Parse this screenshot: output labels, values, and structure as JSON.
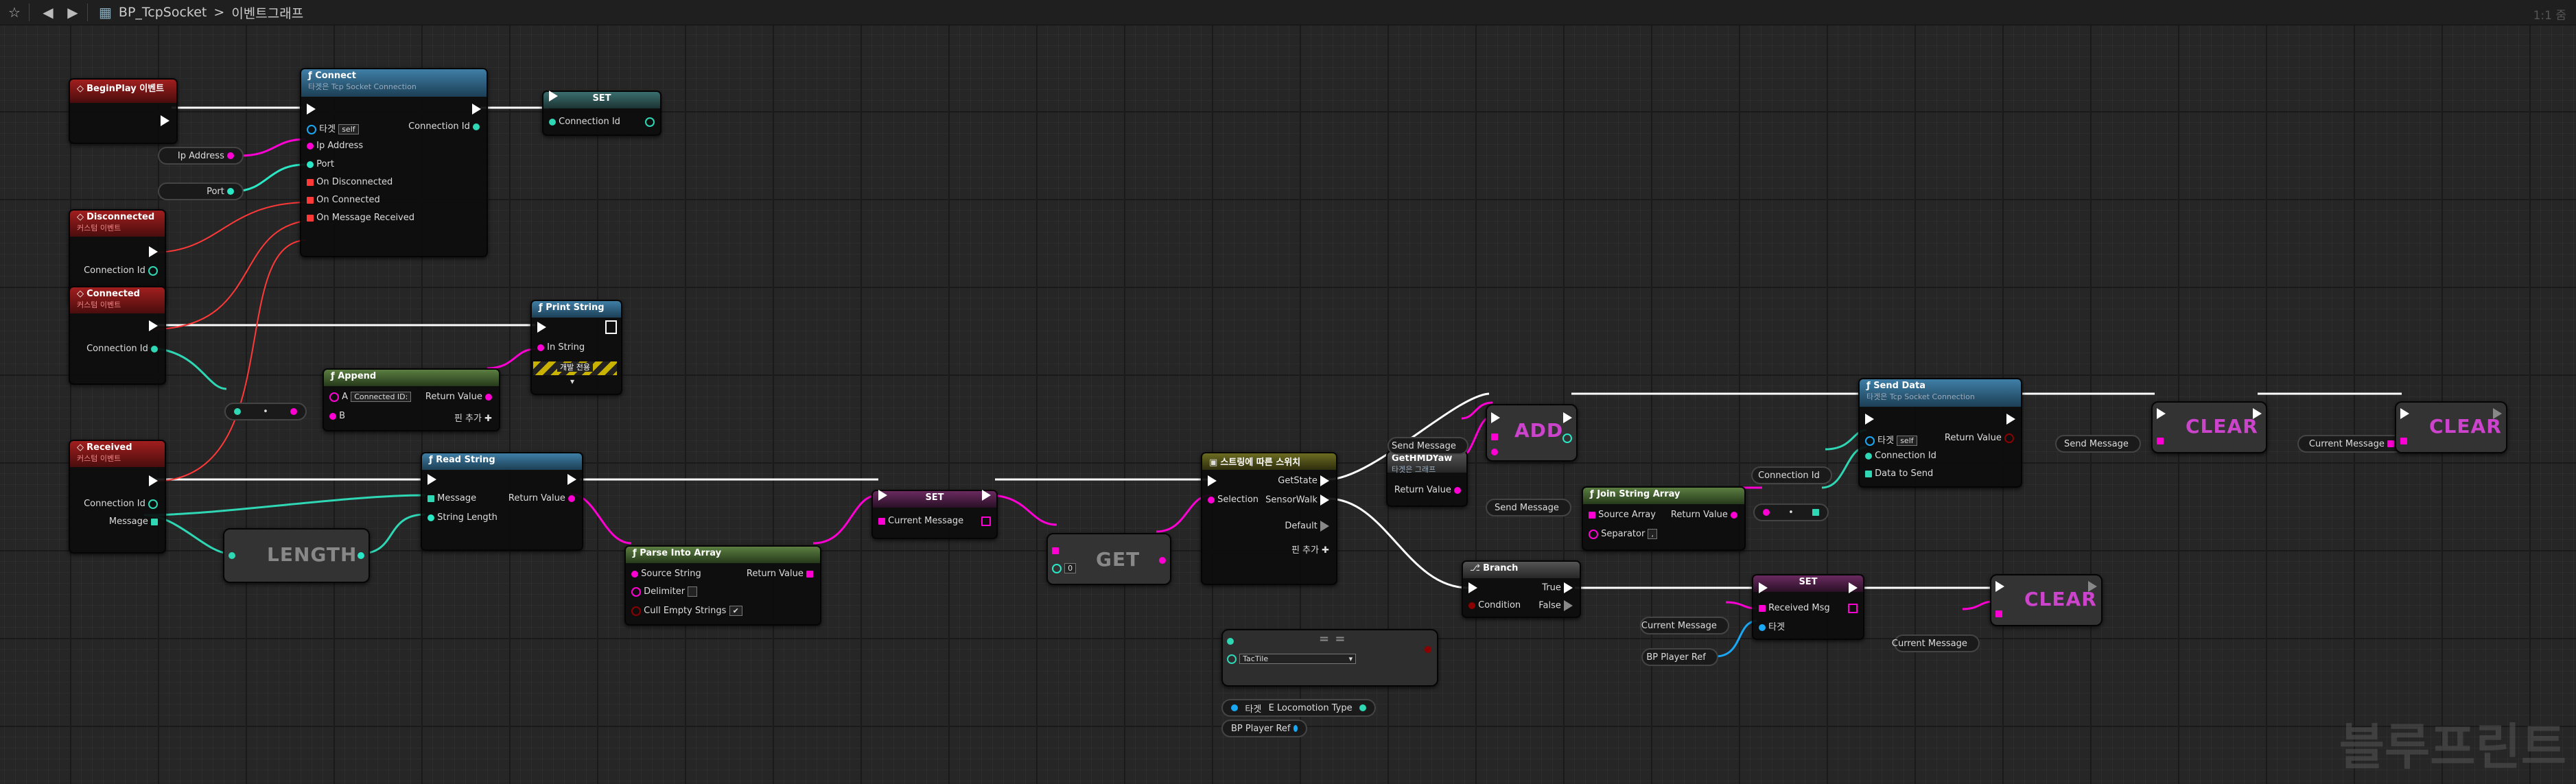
{
  "toolbar": {
    "title": "BP_TcpSocket",
    "sep": ">",
    "graph": "이벤트그래프",
    "zoom": "1:1 줌"
  },
  "watermark": "블루프린트",
  "nodes": {
    "begin_play": {
      "title": "BeginPlay 이벤트"
    },
    "connect": {
      "title": "Connect",
      "subtitle": "타겟은 Tcp Socket Connection",
      "target_label": "타겟",
      "target_value": "self",
      "pins": [
        "Ip Address",
        "Port",
        "On Disconnected",
        "On Connected",
        "On Message Received"
      ],
      "return": "Connection Id"
    },
    "set_top": {
      "title": "SET",
      "pin": "Connection Id"
    },
    "ip_var": "Ip Address",
    "port_var": "Port",
    "disconnected": {
      "title": "Disconnected",
      "subtitle": "커스텀 이벤트",
      "pin": "Connection Id"
    },
    "connected": {
      "title": "Connected",
      "subtitle": "커스텀 이벤트",
      "pin": "Connection Id"
    },
    "print_string": {
      "title": "Print String",
      "pin": "In String",
      "dev": "개발 전용"
    },
    "append": {
      "title": "Append",
      "a_label": "A",
      "a_value": "Connected ID:",
      "b_label": "B",
      "return": "Return Value",
      "add_pin": "핀 추가"
    },
    "conv1": "•",
    "received": {
      "title": "Received",
      "subtitle": "커스텀 이벤트",
      "pin1": "Connection Id",
      "pin2": "Message"
    },
    "read_string": {
      "title": "Read String",
      "pin1": "Message",
      "pin2": "String Length",
      "return": "Return Value"
    },
    "length": "LENGTH",
    "parse": {
      "title": "Parse Into Array",
      "pin1": "Source String",
      "pin2": "Delimiter",
      "pin3": "Cull Empty Strings",
      "return": "Return Value"
    },
    "set_mid": {
      "title": "SET",
      "pin": "Current Message"
    },
    "get": {
      "title": "GET",
      "index": "0"
    },
    "switch": {
      "title": "스트링에 따른 스위치",
      "pin_in": "Selection",
      "out1": "GetState",
      "out2": "SensorWalk",
      "out3": "Default",
      "add_pin": "핀 추가"
    },
    "get_hmd": {
      "title": "GetHMDYaw",
      "subtitle": "타겟은 그래프",
      "return": "Return Value"
    },
    "send_msg_var1": "Send Message",
    "add": "ADD",
    "send_msg_var2": "Send Message",
    "join": {
      "title": "Join String Array",
      "pin1": "Source Array",
      "pin2": "Separator",
      "return": "Return Value"
    },
    "conn_var": "Connection Id",
    "conv2": "•",
    "send_data": {
      "title": "Send Data",
      "subtitle": "타겟은 Tcp Socket Connection",
      "target_label": "타겟",
      "target_value": "self",
      "pin1": "Connection Id",
      "pin2": "Data to Send",
      "return": "Return Value"
    },
    "send_msg_var3": "Send Message",
    "clear1": "CLEAR",
    "cur_msg_var1": "Current Message",
    "clear2": "CLEAR",
    "branch": {
      "title": "Branch",
      "pin": "Condition",
      "true": "True",
      "false": "False"
    },
    "cur_msg_var2": "Current Message",
    "bp_ref1": "BP Player Ref",
    "set_bot": {
      "title": "SET",
      "pin1": "Received Msg",
      "pin2": "타겟"
    },
    "cur_msg_var3": "Current Message",
    "clear3": "CLEAR",
    "enum": {
      "title": "= =",
      "dropdown": "TacTile",
      "target_label": "타겟",
      "type_label": "E Locomotion Type"
    },
    "bp_ref2": "BP Player Ref"
  },
  "colors": {
    "exec": "#ffffff",
    "string": "#ff00d4",
    "struct": "#2fd7b5",
    "delegate": "#ff3838",
    "int": "#2ae8c6",
    "object": "#1aa8f5",
    "bool": "#8b0000"
  }
}
